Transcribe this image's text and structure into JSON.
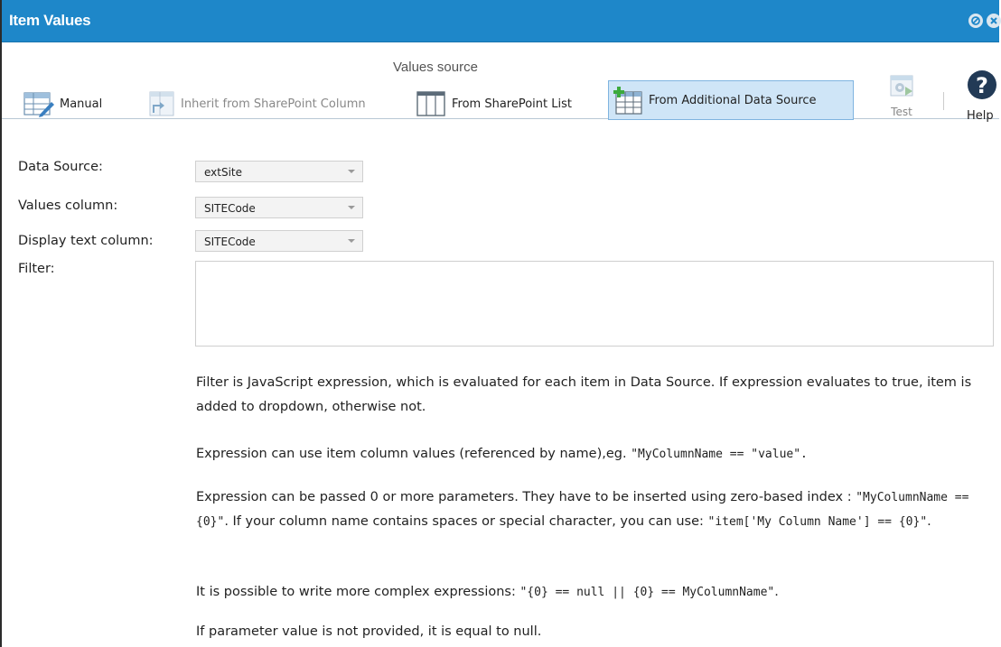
{
  "window": {
    "title": "Item Values"
  },
  "ribbon": {
    "group_label": "Values source",
    "buttons": [
      {
        "label": "Manual",
        "icon": "table-edit-icon",
        "state": "normal"
      },
      {
        "label": "Inherit from SharePoint Column",
        "icon": "inherit-column-icon",
        "state": "disabled"
      },
      {
        "label": "From SharePoint List",
        "icon": "list-columns-icon",
        "state": "normal"
      },
      {
        "label": "From Additional Data Source",
        "icon": "add-data-source-icon",
        "state": "selected"
      }
    ],
    "test_label": "Test",
    "help_label": "Help"
  },
  "form": {
    "data_source": {
      "label": "Data Source:",
      "value": "extSite"
    },
    "values_column": {
      "label": "Values column:",
      "value": "SITECode"
    },
    "display_text_column": {
      "label": "Display text column:",
      "value": "SITECode"
    },
    "filter": {
      "label": "Filter:",
      "value": ""
    }
  },
  "help": {
    "p1": "Filter is JavaScript expression, which is evaluated for each item in Data Source. If expression evaluates to true, item is added to dropdown, otherwise not.",
    "p2_text": "Expression can use item column values (referenced by name),eg. ",
    "p2_code": "\"MyColumnName == \"value\".",
    "p3_text_a": "Expression can be passed 0 or more parameters. They have to be inserted using zero-based index : ",
    "p3_code_a": "\"MyColumnName == {0}\"",
    "p3_text_b": ". If your column name contains spaces or special character, you can use: ",
    "p3_code_b": "\"item['My Column Name'] == {0}\"",
    "p3_text_c": ".",
    "p4_text": "It is possible to write more complex expressions: ",
    "p4_code": "\"{0} == null || {0} == MyColumnName\"",
    "p4_end": ".",
    "p5": "If parameter value is not provided, it is equal to null."
  },
  "colors": {
    "titlebar": "#1e87c9",
    "selected_bg": "#cfe5f7",
    "selected_border": "#7fb4e0"
  }
}
